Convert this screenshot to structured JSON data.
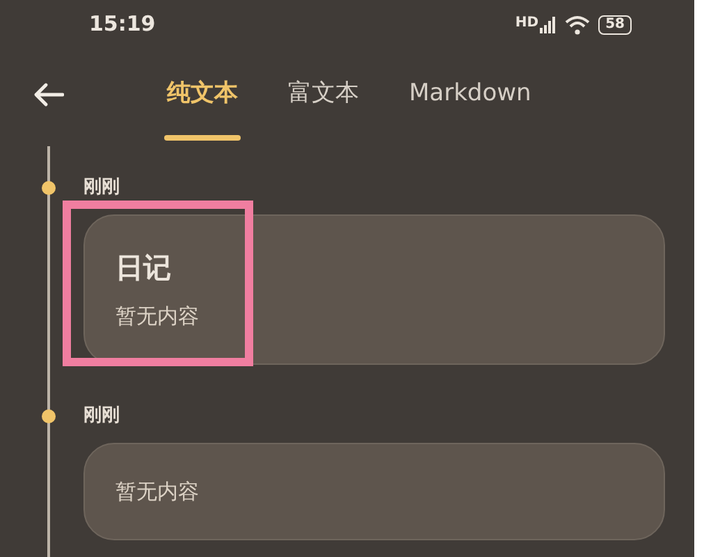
{
  "status_bar": {
    "time": "15:19",
    "signal_label": "HD",
    "battery": "58"
  },
  "tabs": [
    {
      "label": "纯文本",
      "selected": true
    },
    {
      "label": "富文本",
      "selected": false
    },
    {
      "label": "Markdown",
      "selected": false
    }
  ],
  "entries": [
    {
      "time": "刚刚",
      "title": "日记",
      "preview": "暂无内容",
      "highlighted": true
    },
    {
      "time": "刚刚",
      "preview": "暂无内容",
      "highlighted": false
    }
  ]
}
